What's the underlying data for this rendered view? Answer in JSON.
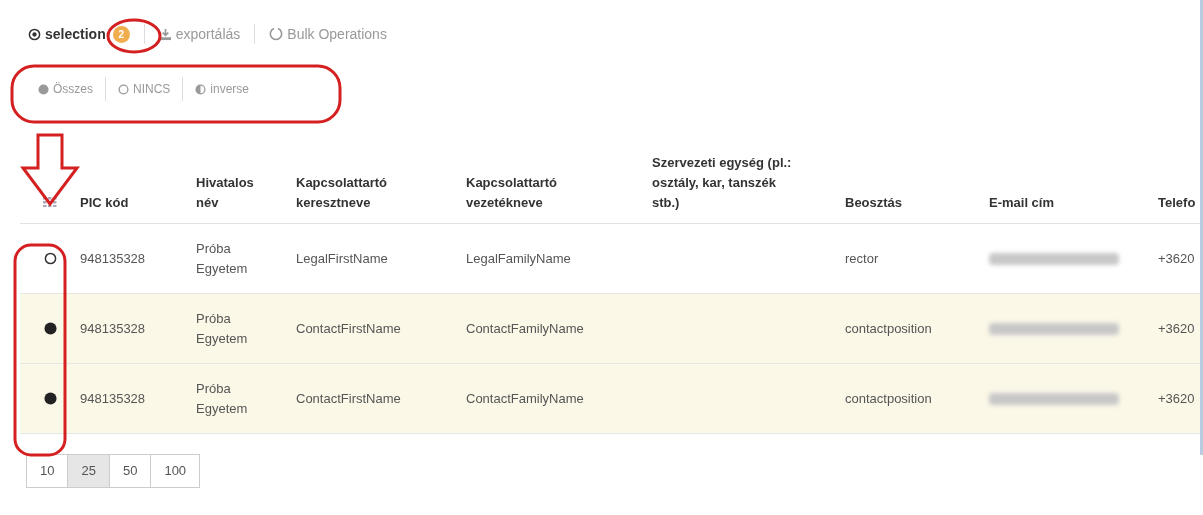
{
  "tabs": [
    {
      "label": "selection",
      "kind": "dot-circle",
      "selected": true,
      "badge": "2"
    },
    {
      "label": "exportálás",
      "kind": "download",
      "selected": false
    },
    {
      "label": "Bulk Operations",
      "kind": "circle-notch",
      "selected": false
    }
  ],
  "select_options": [
    {
      "label": "Összes",
      "kind": "full"
    },
    {
      "label": "NINCS",
      "kind": "empty"
    },
    {
      "label": "inverse",
      "kind": "half"
    }
  ],
  "table": {
    "columns": [
      "PIC kód",
      "Hivatalos név",
      "Kapcsolattartó keresztneve",
      "Kapcsolattartó vezetékneve",
      "Szervezeti egység (pl.: osztály, kar, tanszék stb.)",
      "Beosztás",
      "E-mail cím",
      "Telefo"
    ],
    "rows": [
      {
        "selected": false,
        "cells": [
          "948135328",
          "Próba Egyetem",
          "LegalFirstName",
          "LegalFamilyName",
          "",
          "rector",
          {
            "kind": "redacted"
          },
          "+3620"
        ]
      },
      {
        "selected": true,
        "cells": [
          "948135328",
          "Próba Egyetem",
          "ContactFirstName",
          "ContactFamilyName",
          "",
          "contactposition",
          {
            "kind": "redacted"
          },
          "+3620"
        ]
      },
      {
        "selected": true,
        "cells": [
          "948135328",
          "Próba Egyetem",
          "ContactFirstName",
          "ContactFamilyName",
          "",
          "contactposition",
          {
            "kind": "redacted"
          },
          "+3620"
        ]
      }
    ]
  },
  "page_sizes": [
    {
      "label": "10",
      "selected": false
    },
    {
      "label": "25",
      "selected": true
    },
    {
      "label": "50",
      "selected": false
    },
    {
      "label": "100",
      "selected": false
    }
  ]
}
